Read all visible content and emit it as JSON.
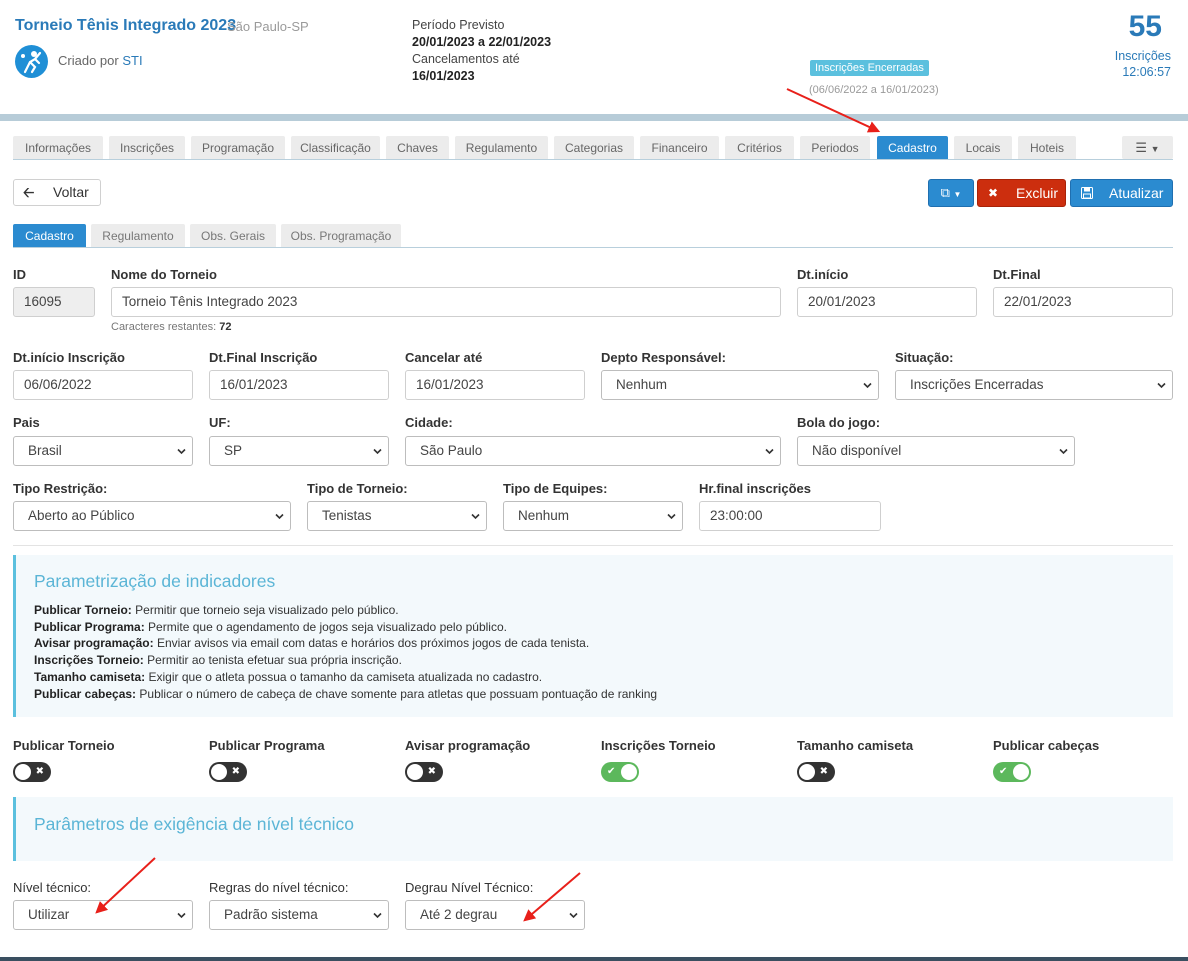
{
  "header": {
    "title": "Torneio Tênis Integrado 2023",
    "city": "São Paulo-SP",
    "created_prefix": "Criado por",
    "created_by": "STI",
    "period_label": "Período Previsto",
    "period_value": "20/01/2023 a 22/01/2023",
    "cancel_label": "Cancelamentos até",
    "cancel_value": "16/01/2023",
    "status_badge": "Inscrições Encerradas",
    "status_range": "(06/06/2022 a 16/01/2023)",
    "count": "55",
    "count_label": "Inscrições",
    "clock": "12:06:57"
  },
  "tabs": [
    {
      "label": "Informações"
    },
    {
      "label": "Inscrições"
    },
    {
      "label": "Programação"
    },
    {
      "label": "Classificação"
    },
    {
      "label": "Chaves"
    },
    {
      "label": "Regulamento"
    },
    {
      "label": "Categorias"
    },
    {
      "label": "Financeiro"
    },
    {
      "label": "Critérios"
    },
    {
      "label": "Periodos"
    },
    {
      "label": "Cadastro",
      "active": true
    },
    {
      "label": "Locais"
    },
    {
      "label": "Hoteis"
    }
  ],
  "toolbar": {
    "back_label": "Voltar",
    "delete_label": "Excluir",
    "update_label": "Atualizar"
  },
  "subtabs": [
    {
      "label": "Cadastro",
      "active": true
    },
    {
      "label": "Regulamento"
    },
    {
      "label": "Obs. Gerais"
    },
    {
      "label": "Obs. Programação"
    }
  ],
  "form": {
    "id": {
      "label": "ID",
      "value": "16095"
    },
    "nome": {
      "label": "Nome do Torneio",
      "value": "Torneio Tênis Integrado 2023",
      "hint_label": "Caracteres restantes:",
      "hint_value": "72"
    },
    "dt_inicio": {
      "label": "Dt.início",
      "value": "20/01/2023"
    },
    "dt_final": {
      "label": "Dt.Final",
      "value": "22/01/2023"
    },
    "dt_inicio_insc": {
      "label": "Dt.início Inscrição",
      "value": "06/06/2022"
    },
    "dt_final_insc": {
      "label": "Dt.Final Inscrição",
      "value": "16/01/2023"
    },
    "cancelar_ate": {
      "label": "Cancelar até",
      "value": "16/01/2023"
    },
    "depto": {
      "label": "Depto Responsável:",
      "value": "Nenhum"
    },
    "situacao": {
      "label": "Situação:",
      "value": "Inscrições Encerradas"
    },
    "pais": {
      "label": "Pais",
      "value": "Brasil"
    },
    "uf": {
      "label": "UF:",
      "value": "SP"
    },
    "cidade": {
      "label": "Cidade:",
      "value": "São Paulo"
    },
    "bola": {
      "label": "Bola do jogo:",
      "value": "Não disponível"
    },
    "tipo_restricao": {
      "label": "Tipo Restrição:",
      "value": "Aberto ao Público"
    },
    "tipo_torneio": {
      "label": "Tipo de Torneio:",
      "value": "Tenistas"
    },
    "tipo_equipes": {
      "label": "Tipo de Equipes:",
      "value": "Nenhum"
    },
    "hr_final": {
      "label": "Hr.final inscrições",
      "value": "23:00:00"
    }
  },
  "indicadores": {
    "title": "Parametrização de indicadores",
    "lines": [
      {
        "term": "Publicar Torneio:",
        "desc": "Permitir que torneio seja visualizado pelo público."
      },
      {
        "term": "Publicar Programa:",
        "desc": "Permite que o agendamento de jogos seja visualizado pelo público."
      },
      {
        "term": "Avisar programação:",
        "desc": "Enviar avisos via email com datas e horários dos próximos jogos de cada tenista."
      },
      {
        "term": "Inscrições Torneio:",
        "desc": "Permitir ao tenista efetuar sua própria inscrição."
      },
      {
        "term": "Tamanho camiseta:",
        "desc": "Exigir que o atleta possua o tamanho da camiseta atualizada no cadastro."
      },
      {
        "term": "Publicar cabeças:",
        "desc": "Publicar o número de cabeça de chave somente para atletas que possuam pontuação de ranking"
      }
    ]
  },
  "toggles": [
    {
      "label": "Publicar Torneio",
      "on": false
    },
    {
      "label": "Publicar Programa",
      "on": false
    },
    {
      "label": "Avisar programação",
      "on": false
    },
    {
      "label": "Inscrições Torneio",
      "on": true
    },
    {
      "label": "Tamanho camiseta",
      "on": false
    },
    {
      "label": "Publicar cabeças",
      "on": true
    }
  ],
  "nivel": {
    "title": "Parâmetros de exigência de nível técnico",
    "nivel_tecnico": {
      "label": "Nível técnico:",
      "value": "Utilizar"
    },
    "regras": {
      "label": "Regras do nível técnico:",
      "value": "Padrão sistema"
    },
    "degrau": {
      "label": "Degrau Nível Técnico:",
      "value": "Até 2 degrau"
    }
  },
  "colors": {
    "primary": "#2b8bd0",
    "danger": "#cc2e0e",
    "info": "#5bc0de",
    "toggle_on": "#5cb85c",
    "toggle_off": "#333333",
    "annotation_arrow": "#e8201a"
  }
}
